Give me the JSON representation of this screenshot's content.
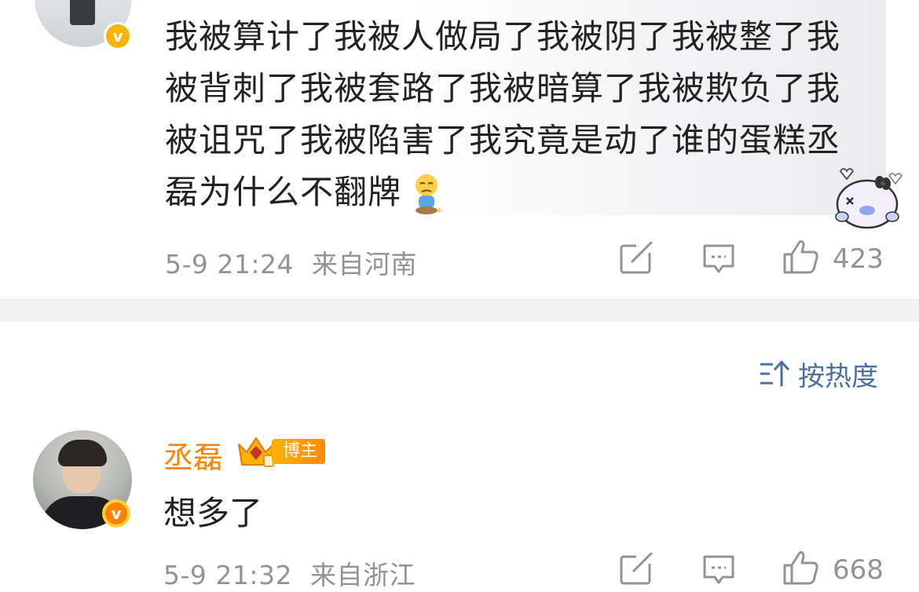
{
  "comment1": {
    "text": "我被算计了我被人做局了我被阴了我被整了我被背刺了我被套路了我被暗算了我被欺负了我被诅咒了我被陷害了我究竟是动了谁的蛋糕丞磊为什么不翻牌",
    "time": "5-9 21:24",
    "location": "来自河南",
    "likes": "423",
    "emoji": "sad-kneeling-face",
    "sticker": "bunny-ghost-sticker"
  },
  "sort": {
    "label": "按热度",
    "icon": "sort-icon"
  },
  "comment2": {
    "username": "丞磊",
    "badge_label": "博主",
    "text": "想多了",
    "time": "5-9 21:32",
    "location": "来自浙江",
    "likes": "668"
  },
  "colors": {
    "username": "#ff8200",
    "meta": "#939393",
    "sort": "#4a6fa0",
    "verified_gold": "#f7b500",
    "verified_orange": "#ff8200",
    "divider": "#f2f2f2"
  },
  "icons": {
    "repost": "repost-icon",
    "comment": "comment-icon",
    "like": "like-icon",
    "verified": "verified-badge-icon",
    "crown": "crown-icon"
  }
}
